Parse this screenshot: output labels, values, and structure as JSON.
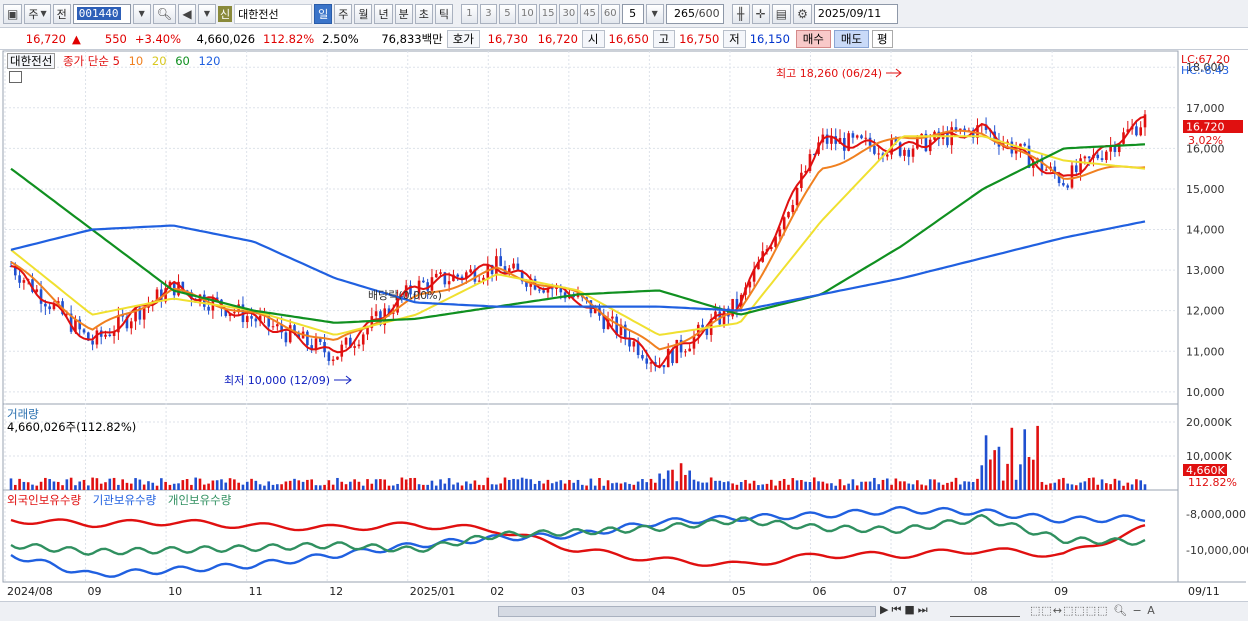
{
  "toolbar": {
    "market_select": "주",
    "prev_label": "전",
    "stock_code": "001440",
    "stock_type_tag": "신",
    "stock_name": "대한전선",
    "periods": [
      "일",
      "주",
      "월",
      "년",
      "분",
      "초",
      "틱"
    ],
    "active_period": "일",
    "intervals": [
      "1",
      "3",
      "5",
      "10",
      "15",
      "30",
      "45",
      "60"
    ],
    "interval_value": "5",
    "count_value": "265",
    "count_max": "/600",
    "date_value": "2025/09/11"
  },
  "quote": {
    "price": "16,720",
    "change_arrow": "▲",
    "change": "550",
    "change_pct": "+3.40%",
    "volume": "4,660,026",
    "volume_ratio": "112.82%",
    "turnover_rate": "2.50%",
    "amount": "76,833백만",
    "bid_label": "호가",
    "bid_sell": "16,730",
    "bid_buy": "16,720",
    "open_label": "시",
    "open": "16,650",
    "high_label": "고",
    "high": "16,750",
    "low_label": "저",
    "low": "16,150",
    "buy_button": "매수",
    "sell_button": "매도",
    "eval_button": "평"
  },
  "price_pane": {
    "stock_label": "대한전선",
    "ma_title": "종가 단순",
    "ma_periods": [
      "5",
      "10",
      "20",
      "60",
      "120"
    ],
    "ma_colors": [
      "#e01010",
      "#f08020",
      "#f0e030",
      "#109020",
      "#2060e0"
    ],
    "high_annotation": "최고 18,260 (06/24)",
    "low_annotation": "최저 10,000 (12/09)",
    "dividend_annotation": "배당락(0.00%)",
    "lc_label": "LC:67.20",
    "hc_label": "HC:-8.43",
    "current_price_tag": "16,720",
    "current_pct_tag": "3.02%",
    "y_ticks": [
      "18,000",
      "17,000",
      "16,000",
      "15,000",
      "14,000",
      "13,000",
      "12,000",
      "11,000",
      "10,000"
    ]
  },
  "volume_pane": {
    "title": "거래량",
    "value_label": "4,660,026주(112.82%)",
    "y_ticks": [
      "20,000K",
      "10,000K"
    ],
    "current_tag": "4,660K",
    "current_pct": "112.82%"
  },
  "holding_pane": {
    "legend": [
      "외국인보유수량",
      "기관보유수량",
      "개인보유수량"
    ],
    "legend_colors": [
      "#e01010",
      "#2060e0",
      "#309060"
    ],
    "y_ticks": [
      "-8,000,000",
      "-10,000,000"
    ]
  },
  "x_axis": {
    "labels": [
      "2024/08",
      "09",
      "10",
      "11",
      "12",
      "2025/01",
      "02",
      "03",
      "04",
      "05",
      "06",
      "07",
      "08",
      "09",
      "09/11"
    ]
  },
  "chart_data": {
    "type": "line",
    "title": "대한전선",
    "xlabel": "",
    "ylabel": "",
    "x": [
      "2024/08",
      "09",
      "10",
      "11",
      "12",
      "2025/01",
      "02",
      "03",
      "04",
      "05",
      "06",
      "07",
      "08",
      "09",
      "09/11"
    ],
    "ylim": [
      9700,
      18400
    ],
    "series": [
      {
        "name": "5",
        "values": [
          13100,
          11200,
          12600,
          11800,
          10900,
          12600,
          13100,
          12300,
          10700,
          12200,
          16200,
          16000,
          16500,
          15200,
          16720
        ]
      },
      {
        "name": "10",
        "values": [
          13200,
          11500,
          12500,
          11900,
          11200,
          12300,
          13000,
          12400,
          11000,
          12000,
          15500,
          16300,
          16400,
          15300,
          15600
        ]
      },
      {
        "name": "20",
        "values": [
          13500,
          11900,
          12300,
          12000,
          11400,
          11900,
          12900,
          12500,
          11400,
          11700,
          14200,
          16300,
          16300,
          15700,
          15500
        ]
      },
      {
        "name": "60",
        "values": [
          15500,
          14000,
          12500,
          12000,
          11700,
          11800,
          12100,
          12400,
          12500,
          11900,
          12400,
          13600,
          15000,
          16000,
          16100
        ]
      },
      {
        "name": "120",
        "values": [
          13500,
          14000,
          14100,
          13700,
          12800,
          12200,
          12100,
          12100,
          12100,
          12000,
          12400,
          12800,
          13300,
          13800,
          14200
        ]
      }
    ],
    "annotations": [
      "최고 18,260 (06/24)",
      "최저 10,000 (12/09)",
      "배당락(0.00%)"
    ],
    "high": 18260,
    "low": 10000,
    "last_close": 16720,
    "volume_last": "4,660,026"
  }
}
